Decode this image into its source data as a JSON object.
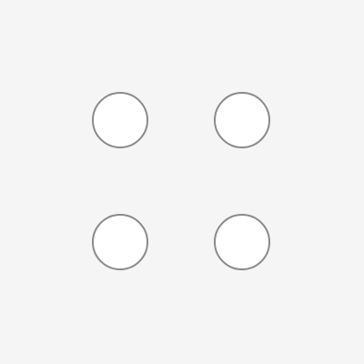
{
  "colors": {
    "background": "#f5f5f5",
    "circle_fill": "#ffffff",
    "circle_border": "#8a8a8a"
  },
  "grid": {
    "rows": 2,
    "columns": 2,
    "items": [
      {
        "id": "top-left"
      },
      {
        "id": "top-right"
      },
      {
        "id": "bottom-left"
      },
      {
        "id": "bottom-right"
      }
    ]
  }
}
